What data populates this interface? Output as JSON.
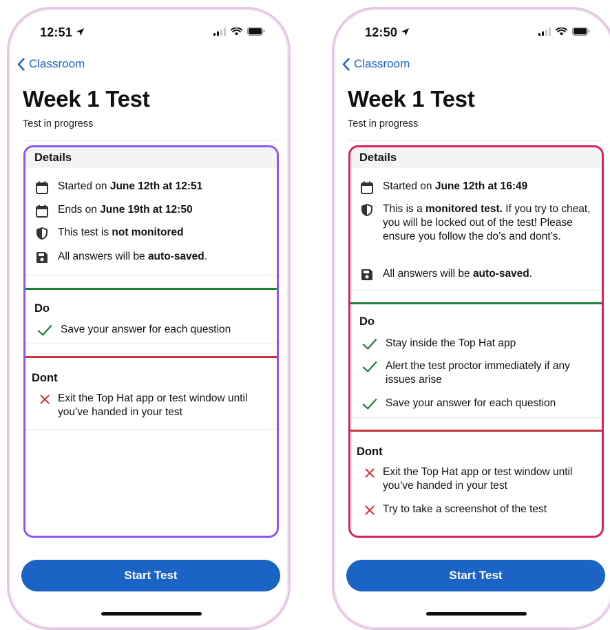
{
  "phones": [
    {
      "status": {
        "time": "12:51"
      },
      "nav": {
        "back_label": "Classroom"
      },
      "title": "Week 1 Test",
      "subtitle": "Test in progress",
      "details": {
        "heading": "Details",
        "started": {
          "pre": "Started on ",
          "bold": "June 12th at 12:51"
        },
        "ends": {
          "pre": "Ends on ",
          "bold": "June 19th at 12:50"
        },
        "monitor": {
          "pre": "This test is ",
          "bold": "not monitored",
          "post": ""
        },
        "autosave": {
          "pre": "All answers will be ",
          "bold": "auto-saved",
          "post": "."
        }
      },
      "do": {
        "heading": "Do",
        "items": [
          "Save your answer for each question"
        ]
      },
      "dont": {
        "heading": "Dont",
        "items": [
          "Exit the Top Hat app or test window until you’ve handed in your test"
        ]
      },
      "start_button": "Start Test"
    },
    {
      "status": {
        "time": "12:50"
      },
      "nav": {
        "back_label": "Classroom"
      },
      "title": "Week 1 Test",
      "subtitle": "Test in progress",
      "details": {
        "heading": "Details",
        "started": {
          "pre": "Started on ",
          "bold": "June 12th at 16:49"
        },
        "monitor": {
          "pre": "This is a ",
          "bold": "monitored test.",
          "post": " If you try to cheat, you will be locked out of the test! Please ensure you follow the do’s and dont’s."
        },
        "autosave": {
          "pre": "All answers will be ",
          "bold": "auto-saved",
          "post": "."
        }
      },
      "do": {
        "heading": "Do",
        "items": [
          "Stay inside the Top Hat app",
          "Alert the test proctor immediately if any issues arise",
          "Save your answer for each question"
        ]
      },
      "dont": {
        "heading": "Dont",
        "items": [
          "Exit the Top Hat app or test window until you’ve handed in your test",
          "Try to take a screenshot of the test"
        ]
      },
      "start_button": "Start Test"
    }
  ],
  "icons": {
    "calendar": "calendar-icon",
    "shield": "shield-icon",
    "save": "save-icon",
    "check": "check-icon",
    "cross": "cross-icon",
    "back": "chevron-left-icon"
  },
  "colors": {
    "accent_blue": "#1b63c4",
    "link_blue": "#1b5fc1",
    "do_green": "#1e7e3e",
    "dont_red": "#c6353d",
    "highlight_purple": "#8e56f5",
    "highlight_pink": "#d9215f"
  }
}
